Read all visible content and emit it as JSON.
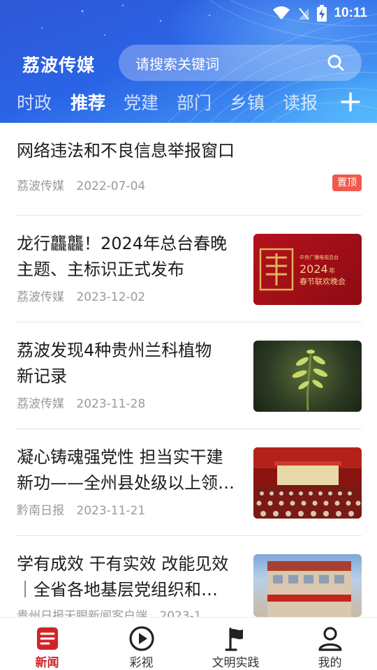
{
  "status_bar": {
    "time": "10:11"
  },
  "header": {
    "brand": "荔波传媒",
    "search_placeholder": "请搜索关键词"
  },
  "tabs": [
    {
      "label": "时政",
      "active": false
    },
    {
      "label": "推荐",
      "active": true
    },
    {
      "label": "党建",
      "active": false
    },
    {
      "label": "部门",
      "active": false
    },
    {
      "label": "乡镇",
      "active": false
    },
    {
      "label": "读报",
      "active": false
    }
  ],
  "news": [
    {
      "title": "网络违法和不良信息举报窗口",
      "source": "荔波传媒",
      "date": "2022-07-04",
      "badge": "置顶"
    },
    {
      "title": "龙行龘龘！2024年总台春晚主题、主标识正式发布",
      "title_lines": [
        "龙行龘龘！2024年总台春晚",
        "主题、主标识正式发布"
      ],
      "source": "荔波传媒",
      "date": "2023-12-02",
      "thumb": "spring-gala-thumbnail",
      "thumb_text": {
        "top": "中央广播电视总台",
        "year": "2024",
        "suffix": "年",
        "sub": "春节联欢晚会"
      }
    },
    {
      "title": "荔波发现4种贵州兰科植物新记录",
      "title_lines": [
        "荔波发现4种贵州兰科植物",
        "新记录"
      ],
      "source": "荔波传媒",
      "date": "2023-11-28",
      "thumb": "orchid-plant-thumbnail"
    },
    {
      "title": "凝心铸魂强党性 担当实干建新功——全州县处级以上领…",
      "title_lines": [
        "凝心铸魂强党性 担当实干建",
        "新功——全州县处级以上领…"
      ],
      "source": "黔南日报",
      "date": "2023-11-21",
      "thumb": "auditorium-meeting-thumbnail"
    },
    {
      "title": "学有成效 干有实效 改能见效｜全省各地基层党组织和…",
      "title_lines": [
        "学有成效 干有实效 改能见效",
        "｜全省各地基层党组织和…"
      ],
      "source": "贵州日报天眼新闻客户端",
      "date": "2023-1…",
      "thumb": "party-building-thumbnail"
    }
  ],
  "bottom_nav": [
    {
      "label": "新闻",
      "icon": "news-icon",
      "active": true
    },
    {
      "label": "彩视",
      "icon": "play-icon",
      "active": false
    },
    {
      "label": "文明实践",
      "icon": "flag-icon",
      "active": false
    },
    {
      "label": "我的",
      "icon": "user-icon",
      "active": false
    }
  ],
  "colors": {
    "accent": "#d2232a",
    "header_blue": "#2a64e6",
    "badge_red": "#f05a4b"
  }
}
